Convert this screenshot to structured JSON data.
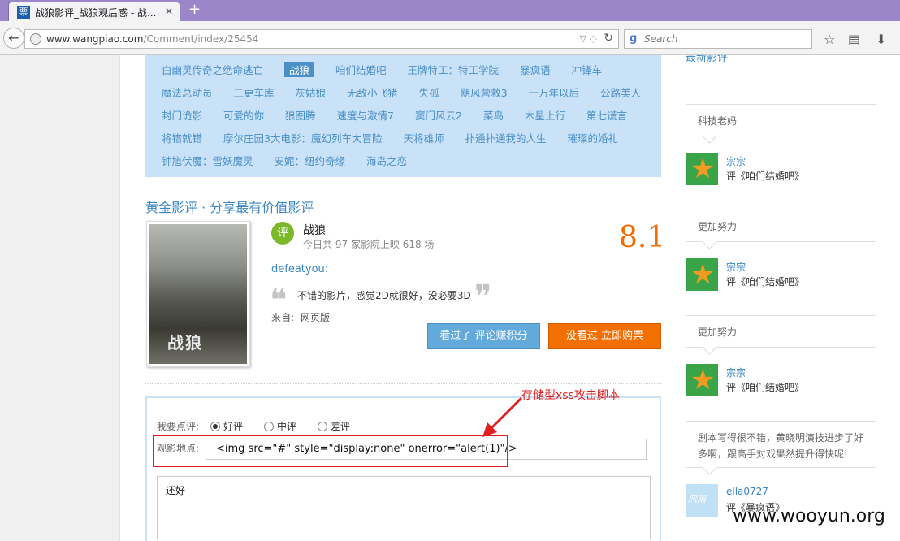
{
  "browser": {
    "tab_title": "战狼影评_战狼观后感 - 战...",
    "tab_icon": "票",
    "close_glyph": "✕",
    "newtab_glyph": "+",
    "url_host": "www.wangpiao.com",
    "url_path": "/Comment/index/25454",
    "search_placeholder": "Search"
  },
  "tags": {
    "row1": [
      "白幽灵传奇之绝命逃亡",
      "战狼",
      "咱们结婚吧",
      "王牌特工：特工学院",
      "暴疯语",
      "冲锋车"
    ],
    "row2": [
      "魔法总动员",
      "三更车库",
      "灰姑娘",
      "无敌小飞猪",
      "失孤",
      "飓风营救3",
      "一万年以后",
      "公路美人"
    ],
    "row3": [
      "封门诡影",
      "可爱的你",
      "狼图腾",
      "速度与激情7",
      "窦门风云2",
      "菜鸟",
      "木星上行",
      "第七谎言"
    ],
    "row4": [
      "将错就错",
      "摩尔庄园3大电影：魔幻列车大冒险",
      "天将雄师",
      "扑通扑通我的人生",
      "璀璨的婚礼"
    ],
    "row5": [
      "钟馗伏魔：雪妖魔灵",
      "安妮：纽约奇缘",
      "海岛之恋"
    ],
    "selected": "战狼"
  },
  "review": {
    "section_title": "黄金影评 · 分享最有价值影评",
    "badge": "评",
    "movie_name": "战狼",
    "meta": "今日共 97 家影院上映 618 场",
    "score": "8.1",
    "reviewer": "defeatyou:",
    "quote_open": "❝",
    "quote_close": "❞",
    "text": "不错的影片，感觉2D就很好，没必要3D",
    "source_label": "来自:",
    "source_value": "网页版",
    "seen_button": "看过了 评论赚积分",
    "buy_button": "没看过 立即购票",
    "poster_title": "战狼"
  },
  "form": {
    "rating_label": "我要点评:",
    "options": [
      "好评",
      "中评",
      "差评"
    ],
    "selected_option": "好评",
    "location_label": "观影地点:",
    "location_value": "<img src=\"#\" style=\"display:none\" onerror=\"alert(1)\"/>",
    "comment_value": "还好"
  },
  "annotation": {
    "text": "存储型xss攻击脚本"
  },
  "sidebar": {
    "cut_title": "最新影评",
    "items": [
      {
        "bubble": "科技老妈",
        "user": "宗宗",
        "movie": "评《咱们结婚吧》"
      },
      {
        "bubble": "更加努力",
        "user": "宗宗",
        "movie": "评《咱们结婚吧》"
      },
      {
        "bubble": "更加努力",
        "user": "宗宗",
        "movie": "评《咱们结婚吧》"
      },
      {
        "bubble": "剧本写得很不错，黄晓明演技进步了好多啊，跟高手对戏果然提升得快呢!",
        "user": "ella0727",
        "movie": "评《暴疯语》"
      }
    ]
  },
  "watermark": "www.wooyun.org"
}
